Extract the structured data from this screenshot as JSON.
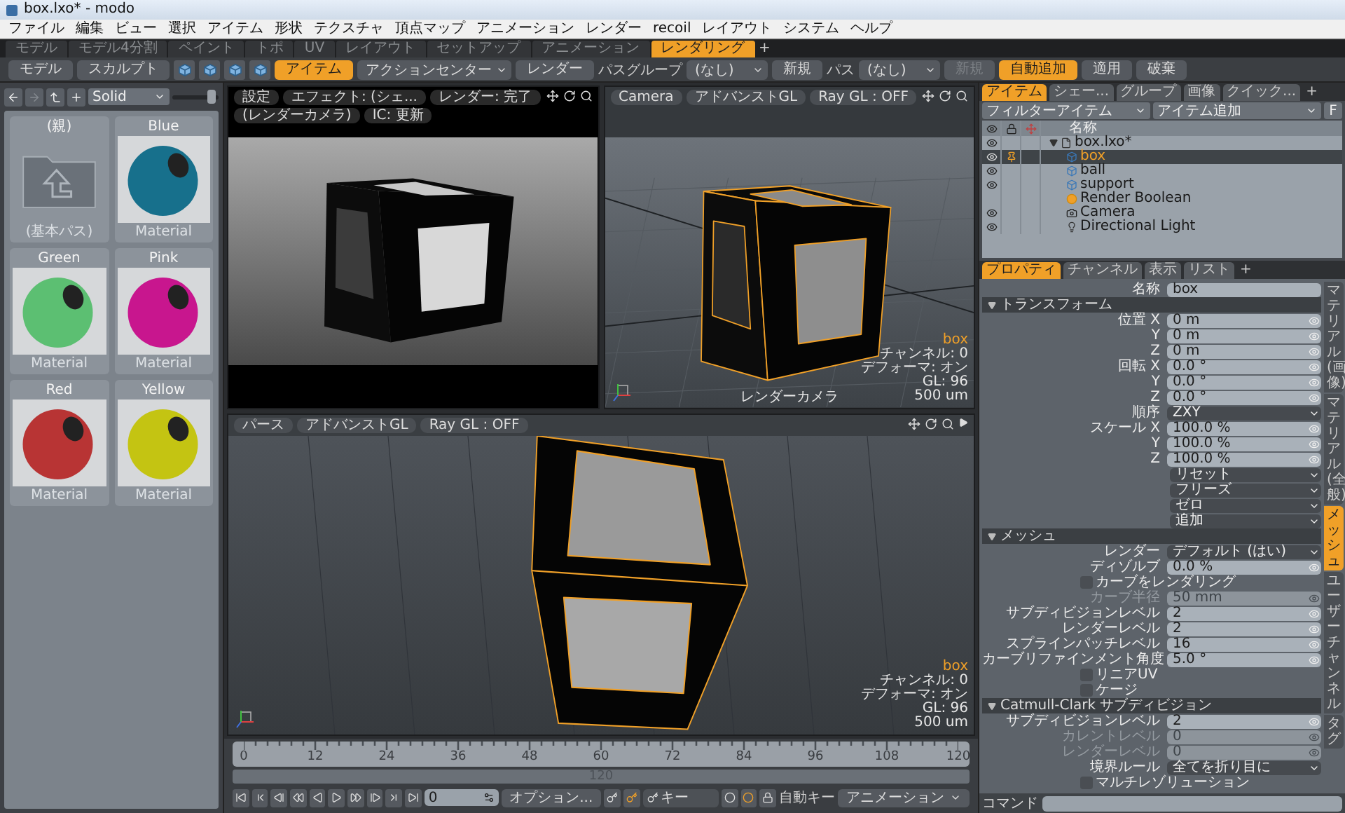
{
  "window": {
    "title": "box.lxo* - modo"
  },
  "menu": [
    "ファイル",
    "編集",
    "ビュー",
    "選択",
    "アイテム",
    "形状",
    "テクスチャ",
    "頂点マップ",
    "アニメーション",
    "レンダー",
    "recoil",
    "レイアウト",
    "システム",
    "ヘルプ"
  ],
  "layout_tabs": [
    {
      "label": "モデル",
      "selected": false
    },
    {
      "label": "モデル4分割",
      "selected": false
    },
    {
      "label": "ペイント",
      "selected": false
    },
    {
      "label": "トポ",
      "selected": false
    },
    {
      "label": "UV",
      "selected": false
    },
    {
      "label": "レイアウト",
      "selected": false
    },
    {
      "label": "セットアップ",
      "selected": false
    },
    {
      "label": "アニメーション",
      "selected": false
    },
    {
      "label": "レンダリング",
      "selected": true
    }
  ],
  "layout_add": "+",
  "toolbar": [
    {
      "kind": "button",
      "label": "モデル",
      "selected": false,
      "disabled": false
    },
    {
      "kind": "button",
      "label": "スカルプト",
      "selected": false,
      "disabled": false
    },
    {
      "kind": "icon",
      "selected": false
    },
    {
      "kind": "icon",
      "selected": false
    },
    {
      "kind": "icon",
      "selected": false
    },
    {
      "kind": "icon",
      "selected": false
    },
    {
      "kind": "button",
      "label": "アイテム",
      "selected": true,
      "disabled": false
    },
    {
      "kind": "dropdown",
      "label": "アクションセンター"
    },
    {
      "kind": "button",
      "label": "レンダー",
      "selected": false,
      "disabled": false
    },
    {
      "kind": "label",
      "label": "パスグループ"
    },
    {
      "kind": "dropdown",
      "label": "(なし)"
    },
    {
      "kind": "button",
      "label": "新規",
      "selected": false,
      "disabled": false
    },
    {
      "kind": "label",
      "label": "パス"
    },
    {
      "kind": "dropdown",
      "label": "(なし)"
    },
    {
      "kind": "button",
      "label": "新規",
      "selected": false,
      "disabled": true
    },
    {
      "kind": "button",
      "label": "自動追加",
      "selected": true,
      "disabled": false
    },
    {
      "kind": "button",
      "label": "適用",
      "selected": false,
      "disabled": false
    },
    {
      "kind": "button",
      "label": "破棄",
      "selected": false,
      "disabled": false
    }
  ],
  "preset_browser": {
    "forward_enabled": false,
    "view_mode": "Solid",
    "size_slider": {
      "level": 0.85
    },
    "tiles": [
      {
        "kind": "folder",
        "title": "(親)",
        "caption": "(基本パス)"
      },
      {
        "kind": "material",
        "title": "Blue",
        "caption": "Material",
        "color": "#17708c"
      },
      {
        "kind": "material",
        "title": "Green",
        "caption": "Material",
        "color": "#5cbf72"
      },
      {
        "kind": "material",
        "title": "Pink",
        "caption": "Material",
        "color": "#c8168e"
      },
      {
        "kind": "material",
        "title": "Red",
        "caption": "Material",
        "color": "#b83434"
      },
      {
        "kind": "material",
        "title": "Yellow",
        "caption": "Material",
        "color": "#c4c412"
      }
    ]
  },
  "viewports": [
    {
      "kind": "render",
      "button_rows": [
        [
          "設定",
          "エフェクト: (シェ...",
          "レンダー: 完了"
        ],
        [
          "(レンダーカメラ)",
          "IC: 更新"
        ]
      ]
    },
    {
      "kind": "camera",
      "button_rows": [
        [
          "Camera",
          "アドバンストGL",
          "Ray GL : OFF"
        ]
      ],
      "info": {
        "item": "box",
        "lines": [
          "チャンネル: 0",
          "デフォーマ: オン",
          "GL: 96",
          "500 um"
        ]
      },
      "caption": "レンダーカメラ"
    },
    {
      "kind": "perspective",
      "button_rows": [
        [
          "パース",
          "アドバンストGL",
          "Ray GL : OFF"
        ]
      ],
      "info": {
        "item": "box",
        "lines": [
          "チャンネル: 0",
          "デフォーマ: オン",
          "GL: 96",
          "500 um"
        ]
      }
    }
  ],
  "timeline": {
    "ticks": [
      "0",
      "12",
      "24",
      "36",
      "48",
      "60",
      "72",
      "84",
      "96",
      "108",
      "120"
    ],
    "range_end": "120",
    "frame": "0",
    "options_button": "オプション...",
    "key_field": "キー",
    "auto_key_label": "自動キー",
    "mode_dropdown": "アニメーション"
  },
  "outliner": {
    "tabs": [
      {
        "label": "アイテム",
        "selected": true
      },
      {
        "label": "シェー...",
        "selected": false
      },
      {
        "label": "グループ",
        "selected": false
      },
      {
        "label": "画像",
        "selected": false
      },
      {
        "label": "クイック...",
        "selected": false
      }
    ],
    "add_tab": "+",
    "filter": "フィルターアイテム",
    "add_item": "アイテム追加",
    "filter_button": "F",
    "name_column": "名称",
    "items": [
      {
        "name": "box.lxo*",
        "kind": "scene",
        "visible": true,
        "selected": false,
        "expanded": true,
        "children": [
          {
            "name": "box",
            "kind": "mesh",
            "visible": true,
            "selected": true
          },
          {
            "name": "ball",
            "kind": "mesh",
            "visible": true,
            "selected": false
          },
          {
            "name": "support",
            "kind": "mesh",
            "visible": true,
            "selected": false
          },
          {
            "name": "Render Boolean",
            "kind": "boolean",
            "visible": false,
            "selected": false
          },
          {
            "name": "Camera",
            "kind": "camera",
            "visible": true,
            "selected": false
          },
          {
            "name": "Directional Light",
            "kind": "light",
            "visible": true,
            "selected": false
          }
        ]
      }
    ]
  },
  "properties": {
    "tabs": [
      {
        "label": "プロパティ",
        "selected": true
      },
      {
        "label": "チャンネル",
        "selected": false
      },
      {
        "label": "表示",
        "selected": false
      },
      {
        "label": "リスト",
        "selected": false
      }
    ],
    "add_tab": "+",
    "side_tabs": [
      {
        "label": "マテリアル(画像)",
        "selected": false
      },
      {
        "label": "マテリアル(全般)",
        "selected": false
      },
      {
        "label": "メッシュ",
        "selected": true
      },
      {
        "label": "ユーザーチャンネル",
        "selected": false
      },
      {
        "label": "タグ",
        "selected": false
      }
    ],
    "rows": [
      {
        "kind": "text",
        "label": "名称",
        "value": "box",
        "disabled": false
      },
      {
        "kind": "header",
        "label": "トランスフォーム",
        "expanded": true
      },
      {
        "kind": "number",
        "label": "位置 X",
        "value": "0 m",
        "disabled": false
      },
      {
        "kind": "number",
        "label": "Y",
        "value": "0 m",
        "disabled": false
      },
      {
        "kind": "number",
        "label": "Z",
        "value": "0 m",
        "disabled": false
      },
      {
        "kind": "number",
        "label": "回転 X",
        "value": "0.0 °",
        "disabled": false
      },
      {
        "kind": "number",
        "label": "Y",
        "value": "0.0 °",
        "disabled": false
      },
      {
        "kind": "number",
        "label": "Z",
        "value": "0.0 °",
        "disabled": false
      },
      {
        "kind": "select",
        "label": "順序",
        "value": "ZXY",
        "disabled": false
      },
      {
        "kind": "number",
        "label": "スケール X",
        "value": "100.0 %",
        "disabled": false
      },
      {
        "kind": "number",
        "label": "Y",
        "value": "100.0 %",
        "disabled": false
      },
      {
        "kind": "number",
        "label": "Z",
        "value": "100.0 %",
        "disabled": false
      },
      {
        "kind": "action",
        "value": "リセット",
        "disabled": false
      },
      {
        "kind": "action",
        "value": "フリーズ",
        "disabled": false
      },
      {
        "kind": "action",
        "value": "ゼロ",
        "disabled": false
      },
      {
        "kind": "action",
        "value": "追加",
        "disabled": false
      },
      {
        "kind": "header",
        "label": "メッシュ",
        "expanded": true
      },
      {
        "kind": "select",
        "label": "レンダー",
        "value": "デフォルト (はい)",
        "disabled": false
      },
      {
        "kind": "number",
        "label": "ディゾルブ",
        "value": "0.0 %",
        "disabled": false
      },
      {
        "kind": "checkbox",
        "label": "カーブをレンダリング",
        "checked": false,
        "disabled": false
      },
      {
        "kind": "number",
        "label": "カーブ半径",
        "value": "50 mm",
        "disabled": true
      },
      {
        "kind": "number",
        "label": "サブディビジョンレベル",
        "value": "2",
        "disabled": false
      },
      {
        "kind": "number",
        "label": "レンダーレベル",
        "value": "2",
        "disabled": false
      },
      {
        "kind": "number",
        "label": "スプラインパッチレベル",
        "value": "16",
        "disabled": false
      },
      {
        "kind": "number",
        "label": "カーブリファインメント角度",
        "value": "5.0 °",
        "disabled": false
      },
      {
        "kind": "checkbox",
        "label": "リニアUV",
        "checked": false,
        "disabled": false
      },
      {
        "kind": "checkbox",
        "label": "ケージ",
        "checked": false,
        "disabled": false
      },
      {
        "kind": "header",
        "label": "Catmull-Clark サブディビジョン",
        "expanded": true
      },
      {
        "kind": "number",
        "label": "サブディビジョンレベル",
        "value": "2",
        "disabled": false
      },
      {
        "kind": "number",
        "label": "カレントレベル",
        "value": "0",
        "disabled": true
      },
      {
        "kind": "number",
        "label": "レンダーレベル",
        "value": "0",
        "disabled": true
      },
      {
        "kind": "select",
        "label": "境界ルール",
        "value": "全てを折り目に",
        "disabled": false
      },
      {
        "kind": "checkbox",
        "label": "マルチレゾリューション",
        "checked": false,
        "disabled": false
      }
    ]
  },
  "command": {
    "label": "コマンド"
  }
}
